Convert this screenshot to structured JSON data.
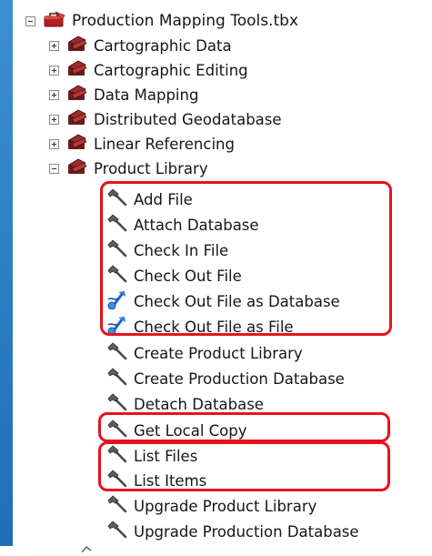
{
  "tree": {
    "root": {
      "label": "Production Mapping Tools.tbx",
      "icon": "toolbox-icon",
      "expander": "minus"
    },
    "toolsets": [
      {
        "label": "Cartographic Data",
        "icon": "toolset-icon",
        "expander": "plus"
      },
      {
        "label": "Cartographic Editing",
        "icon": "toolset-icon",
        "expander": "plus"
      },
      {
        "label": "Data Mapping",
        "icon": "toolset-icon",
        "expander": "plus"
      },
      {
        "label": "Distributed Geodatabase",
        "icon": "toolset-icon",
        "expander": "plus"
      },
      {
        "label": "Linear Referencing",
        "icon": "toolset-icon",
        "expander": "plus"
      },
      {
        "label": "Product Library",
        "icon": "toolset-icon",
        "expander": "minus"
      }
    ],
    "tools": [
      {
        "label": "Add File",
        "icon": "hammer-icon"
      },
      {
        "label": "Attach Database",
        "icon": "hammer-icon"
      },
      {
        "label": "Check In File",
        "icon": "hammer-icon"
      },
      {
        "label": "Check Out File",
        "icon": "hammer-icon"
      },
      {
        "label": "Check Out File as Database",
        "icon": "script-icon"
      },
      {
        "label": "Check Out File as File",
        "icon": "script-icon"
      },
      {
        "label": "Create Product Library",
        "icon": "hammer-icon"
      },
      {
        "label": "Create Production Database",
        "icon": "hammer-icon"
      },
      {
        "label": "Detach Database",
        "icon": "hammer-icon"
      },
      {
        "label": "Get Local Copy",
        "icon": "hammer-icon"
      },
      {
        "label": "List Files",
        "icon": "hammer-icon"
      },
      {
        "label": "List Items",
        "icon": "hammer-icon"
      },
      {
        "label": "Upgrade Product Library",
        "icon": "hammer-icon"
      },
      {
        "label": "Upgrade Production Database",
        "icon": "hammer-icon"
      }
    ]
  },
  "colors": {
    "highlight": "#e8121b",
    "toolbox": "#c0282a",
    "toolset": "#8a1c1c",
    "left_strip": "#2a7cc5"
  }
}
